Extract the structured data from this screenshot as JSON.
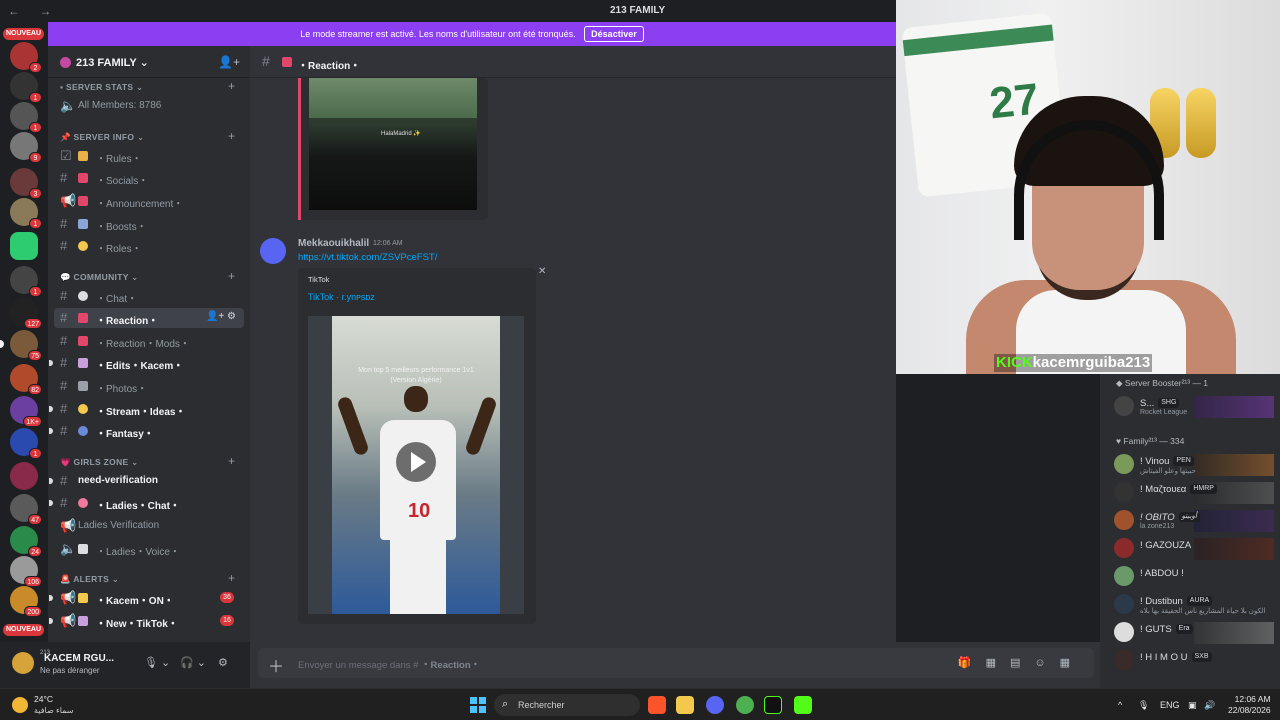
{
  "window": {
    "title": "213 FAMILY"
  },
  "banner": {
    "text": "Le mode streamer est activé. Les noms d'utilisateur ont été tronqués.",
    "button": "Désactiver"
  },
  "rail": {
    "nouveau_top": "NOUVEAU",
    "nouveau_bottom": "NOUVEAU",
    "badges": [
      "2",
      "1",
      "1",
      "9",
      "3",
      "1",
      "1",
      "127",
      "75",
      "82",
      "1K+",
      "1",
      "47",
      "24",
      "106",
      "200"
    ]
  },
  "server": {
    "name": "213 FAMILY"
  },
  "categories": [
    {
      "name": "SERVER STATS",
      "channels": [
        {
          "label": "All Members: 8786",
          "icon": "speaker-icon"
        }
      ]
    },
    {
      "name": "SERVER INFO",
      "channels": [
        {
          "label": "・Rules・",
          "icon": "rules-icon"
        },
        {
          "label": "・Socials・",
          "icon": "hash-icon"
        },
        {
          "label": "・Announcement・",
          "icon": "megaphone-icon"
        },
        {
          "label": "・Boosts・",
          "icon": "hash-icon"
        },
        {
          "label": "・Roles・",
          "icon": "hash-icon"
        }
      ]
    },
    {
      "name": "COMMUNITY",
      "channels": [
        {
          "label": "・Chat・"
        },
        {
          "label": "・Reaction・"
        },
        {
          "label": "・Reaction・Mods・"
        },
        {
          "label": "・Edits・Kacem・"
        },
        {
          "label": "・Photos・"
        },
        {
          "label": "・Stream・Ideas・"
        },
        {
          "label": "・Fantasy・"
        }
      ]
    },
    {
      "name": "GIRLS ZONE",
      "channels": [
        {
          "label": "need-verification"
        },
        {
          "label": "・Ladies・Chat・"
        },
        {
          "label": "Ladies Verification"
        },
        {
          "label": "・Ladies・Voice・"
        }
      ]
    },
    {
      "name": "ALERTS",
      "channels": [
        {
          "label": "・Kacem・ON・",
          "count": "36"
        },
        {
          "label": "・New・TikTok・",
          "count": "16"
        }
      ]
    }
  ],
  "user": {
    "name": "KACEM RGU...",
    "status": "Ne pas déranger",
    "tag": "213"
  },
  "channel": {
    "name": "・Reaction・"
  },
  "embed1": {
    "tag": "HalaMadrid ✨"
  },
  "message": {
    "author": "Mekkaouikhalil",
    "time": "12:06 AM",
    "link": "https://vt.tiktok.com/ZSVPceFST/",
    "provider": "TikTok",
    "embed_title": "TikTok · r.ynᴘsᴅᴢ",
    "caption": "Mon top 5 meilleurs performance 1v1\n(Version Algérie)",
    "jersey_number": "10"
  },
  "composer": {
    "placeholder_prefix": "Envoyer un message dans #",
    "placeholder_channel": "・Reaction・"
  },
  "overlay": {
    "kick_brand": "KICK",
    "kick_user": "kacemrguiba213"
  },
  "members": {
    "groups": [
      {
        "name": "Server Booster²¹³ — 1",
        "items": [
          {
            "name": "S...",
            "tag": "SHG",
            "sub": "Rocket League"
          }
        ]
      },
      {
        "name": "Family²¹³ — 334",
        "items": [
          {
            "name": "! Vinou",
            "tag": "PEN",
            "sub": "حبيتها وعلو الفيتاش"
          },
          {
            "name": "! Μαζτουεα",
            "tag": "HMRP",
            "sub": ""
          },
          {
            "name": "! OBITO",
            "tag": "أوبيتو",
            "sub": "la zone213"
          },
          {
            "name": "! GAZOUZA",
            "tag": "",
            "sub": ""
          },
          {
            "name": "! ABDOU !",
            "tag": "",
            "sub": ""
          },
          {
            "name": "! Dustibun",
            "tag": "AURA",
            "sub": "الكون بلا حياة المشاريع ناس الحقيقة بها بلاه"
          },
          {
            "name": "! GUTS",
            "tag": "Era",
            "sub": ""
          },
          {
            "name": "! H I M O U",
            "tag": "SXB",
            "sub": ""
          }
        ]
      }
    ]
  },
  "taskbar": {
    "temp": "24°C",
    "condition": "سماء صافية",
    "search": "Rechercher",
    "lang": "ENG",
    "time": "12:06 AM",
    "date": "22/08/2026"
  }
}
